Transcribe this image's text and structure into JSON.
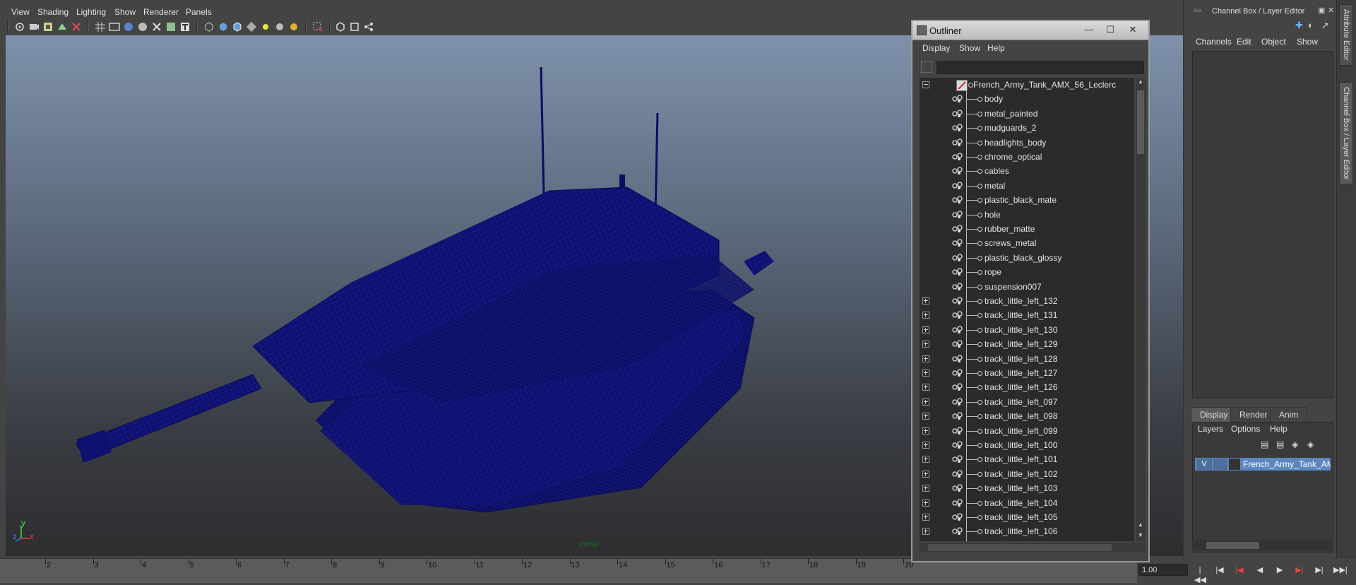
{
  "menubar": {
    "items": [
      "View",
      "Shading",
      "Lighting",
      "Show",
      "Renderer",
      "Panels"
    ]
  },
  "viewport": {
    "camera_label": "persp",
    "axis_labels": {
      "y": "y",
      "x": "x",
      "z": "z"
    },
    "wire_color": "#0d0d66"
  },
  "timeline": {
    "ticks": [
      "2",
      "3",
      "4",
      "5",
      "6",
      "7",
      "8",
      "9",
      "10",
      "11",
      "12",
      "13",
      "14",
      "15",
      "16",
      "17",
      "18",
      "19",
      "20"
    ],
    "current_frame": "1.00",
    "playback_buttons": [
      "go-to-start-icon",
      "step-back-key-icon",
      "step-back-frame-icon",
      "play-backward-icon",
      "play-forward-icon",
      "step-forward-frame-icon",
      "step-forward-key-icon",
      "go-to-end-icon"
    ]
  },
  "right_panel": {
    "title": "Channel Box / Layer Editor",
    "menu": [
      "Channels",
      "Edit",
      "Object",
      "Show"
    ],
    "layer_tabs": [
      "Display",
      "Render",
      "Anim"
    ],
    "layer_menu": [
      "Layers",
      "Options",
      "Help"
    ],
    "layer": {
      "visible": "V",
      "name": "French_Army_Tank_AMX"
    }
  },
  "side_tabs": [
    "Attribute Editor",
    "Channel Box / Layer Editor"
  ],
  "outliner": {
    "title": "Outliner",
    "menu": [
      "Display",
      "Show",
      "Help"
    ],
    "root": "French_Army_Tank_AMX_56_Leclerc",
    "items": [
      {
        "label": "body",
        "expandable": false
      },
      {
        "label": "metal_painted",
        "expandable": false
      },
      {
        "label": "mudguards_2",
        "expandable": false
      },
      {
        "label": "headlights_body",
        "expandable": false
      },
      {
        "label": "chrome_optical",
        "expandable": false
      },
      {
        "label": "cables",
        "expandable": false
      },
      {
        "label": "metal",
        "expandable": false
      },
      {
        "label": "plastic_black_mate",
        "expandable": false
      },
      {
        "label": "hole",
        "expandable": false
      },
      {
        "label": "rubber_matte",
        "expandable": false
      },
      {
        "label": "screws_metal",
        "expandable": false
      },
      {
        "label": "plastic_black_glossy",
        "expandable": false
      },
      {
        "label": "rope",
        "expandable": false
      },
      {
        "label": "suspension007",
        "expandable": false
      },
      {
        "label": "track_little_left_132",
        "expandable": true
      },
      {
        "label": "track_little_left_131",
        "expandable": true
      },
      {
        "label": "track_little_left_130",
        "expandable": true
      },
      {
        "label": "track_little_left_129",
        "expandable": true
      },
      {
        "label": "track_little_left_128",
        "expandable": true
      },
      {
        "label": "track_little_left_127",
        "expandable": true
      },
      {
        "label": "track_little_left_126",
        "expandable": true
      },
      {
        "label": "track_little_left_097",
        "expandable": true
      },
      {
        "label": "track_little_left_098",
        "expandable": true
      },
      {
        "label": "track_little_left_099",
        "expandable": true
      },
      {
        "label": "track_little_left_100",
        "expandable": true
      },
      {
        "label": "track_little_left_101",
        "expandable": true
      },
      {
        "label": "track_little_left_102",
        "expandable": true
      },
      {
        "label": "track_little_left_103",
        "expandable": true
      },
      {
        "label": "track_little_left_104",
        "expandable": true
      },
      {
        "label": "track_little_left_105",
        "expandable": true
      },
      {
        "label": "track_little_left_106",
        "expandable": true
      }
    ]
  }
}
